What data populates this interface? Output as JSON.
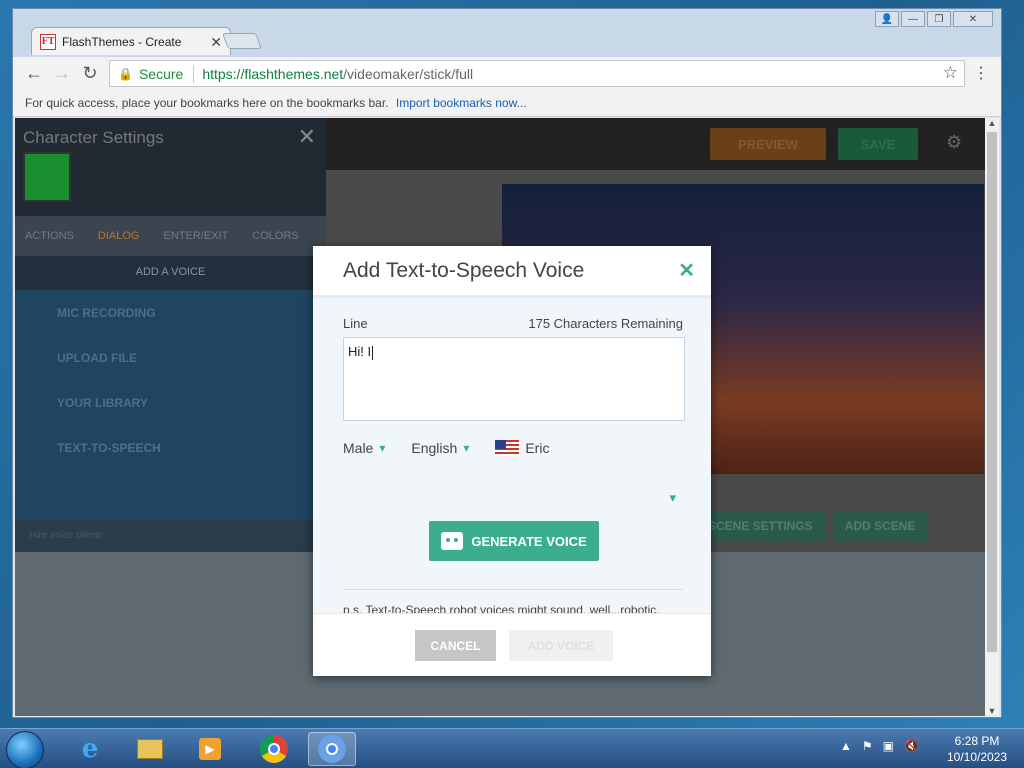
{
  "browser": {
    "tab_title": "FlashThemes - Create",
    "favicon_text": "FT",
    "secure_label": "Secure",
    "url_host": "https://flashthemes.net",
    "url_path": "/videomaker/stick/full",
    "bookmarks_text": "For quick access, place your bookmarks here on the bookmarks bar.",
    "bookmarks_link": "Import bookmarks now..."
  },
  "left_panel": {
    "title": "Character Settings",
    "tabs": [
      "ACTIONS",
      "DIALOG",
      "ENTER/EXIT",
      "COLORS"
    ],
    "add_voice": "ADD A VOICE",
    "items": [
      "MIC RECORDING",
      "UPLOAD FILE",
      "YOUR LIBRARY",
      "TEXT-TO-SPEECH"
    ],
    "hire_label": "Hire voice talent:"
  },
  "stage": {
    "preview": "PREVIEW",
    "save": "SAVE",
    "scene_settings": "SCENE SETTINGS",
    "add_scene": "ADD SCENE"
  },
  "modal": {
    "title": "Add Text-to-Speech Voice",
    "line_label": "Line",
    "chars_remaining": "175 Characters Remaining",
    "line_value": "Hi! I",
    "gender": "Male",
    "language": "English",
    "voice": "Eric",
    "generate": "GENERATE VOICE",
    "ps": "p.s. Text-to-Speech robot voices might sound, well...robotic.",
    "cancel": "CANCEL",
    "add_voice": "ADD VOICE"
  },
  "taskbar": {
    "time": "6:28 PM",
    "date": "10/10/2023"
  },
  "colors": {
    "accent": "#3cae8c"
  }
}
